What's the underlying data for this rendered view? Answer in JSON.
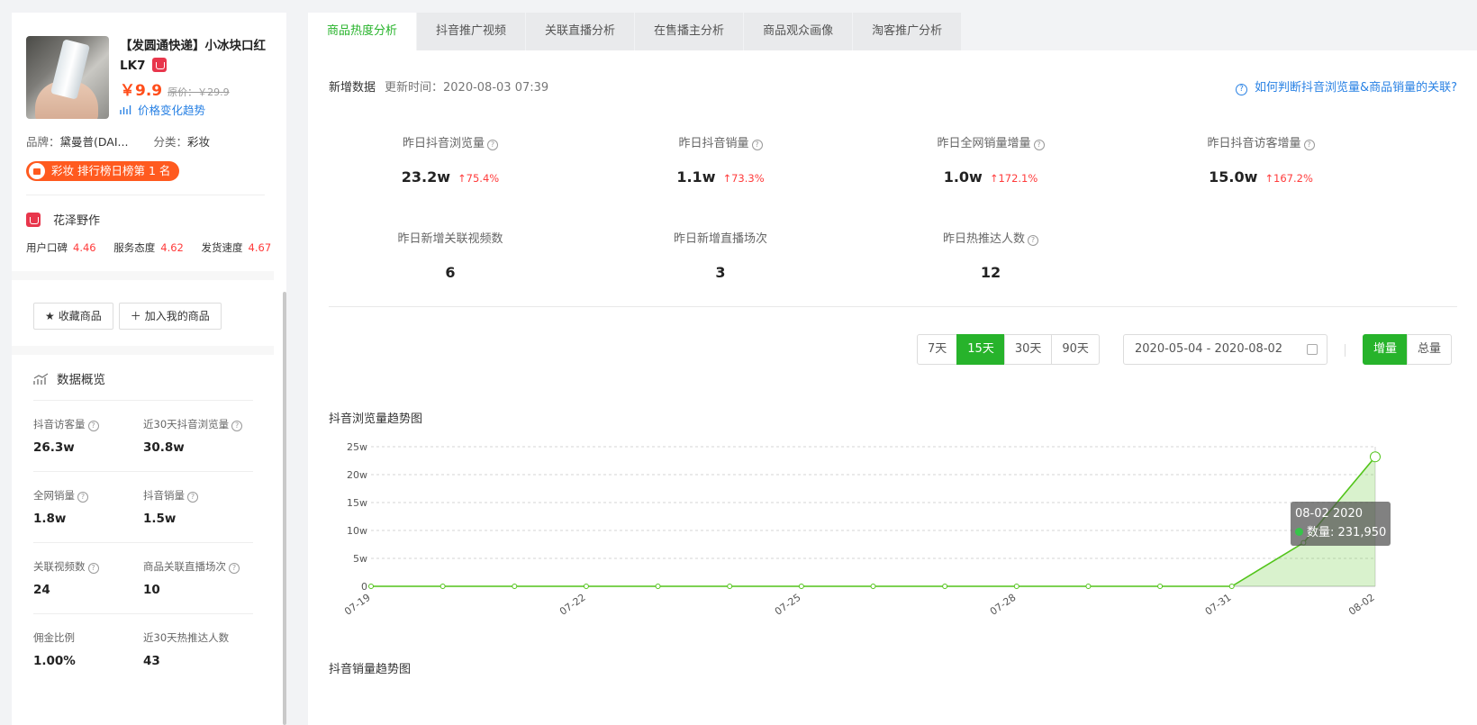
{
  "product": {
    "title": "【发圆通快递】小冰块口红LK7",
    "price": "￥9.9",
    "original_price": "原价：￥29.9",
    "trend_link": "价格变化趋势",
    "brand_label": "品牌：",
    "brand": "黛曼普(DAI...",
    "category_label": "分类：",
    "category": "彩妆",
    "rank_badge": "彩妆 排行榜日榜第 1 名"
  },
  "shop": {
    "name": "花泽野作",
    "scores": [
      {
        "label": "用户口碑",
        "value": "4.46"
      },
      {
        "label": "服务态度",
        "value": "4.62"
      },
      {
        "label": "发货速度",
        "value": "4.67"
      }
    ]
  },
  "actions": {
    "favorite": "收藏商品",
    "add_mine": "加入我的商品"
  },
  "overview": {
    "title": "数据概览",
    "stats": [
      {
        "label": "抖音访客量",
        "value": "26.3w",
        "help": true
      },
      {
        "label": "近30天抖音浏览量",
        "value": "30.8w",
        "help": true
      },
      {
        "label": "全网销量",
        "value": "1.8w",
        "help": true
      },
      {
        "label": "抖音销量",
        "value": "1.5w",
        "help": true
      },
      {
        "label": "关联视频数",
        "value": "24",
        "help": true
      },
      {
        "label": "商品关联直播场次",
        "value": "10",
        "help": true
      },
      {
        "label": "佣金比例",
        "value": "1.00%",
        "help": false
      },
      {
        "label": "近30天热推达人数",
        "value": "43",
        "help": false
      }
    ]
  },
  "tabs": [
    "商品热度分析",
    "抖音推广视频",
    "关联直播分析",
    "在售播主分析",
    "商品观众画像",
    "淘客推广分析"
  ],
  "panel": {
    "section_label": "新增数据",
    "updated": "更新时间：2020-08-03 07:39",
    "help_link": "如何判断抖音浏览量&商品销量的关联?",
    "metrics": [
      {
        "label": "昨日抖音浏览量",
        "value": "23.2w",
        "change": "75.4%",
        "help": true
      },
      {
        "label": "昨日抖音销量",
        "value": "1.1w",
        "change": "73.3%",
        "help": true
      },
      {
        "label": "昨日全网销量增量",
        "value": "1.0w",
        "change": "172.1%",
        "help": true
      },
      {
        "label": "昨日抖音访客增量",
        "value": "15.0w",
        "change": "167.2%",
        "help": true
      },
      {
        "label": "昨日新增关联视频数",
        "value": "6",
        "change": "",
        "help": false
      },
      {
        "label": "昨日新增直播场次",
        "value": "3",
        "change": "",
        "help": false
      },
      {
        "label": "昨日热推达人数",
        "value": "12",
        "change": "",
        "help": true
      }
    ],
    "ranges": [
      "7天",
      "15天",
      "30天",
      "90天"
    ],
    "active_range": "15天",
    "date_range": "2020-05-04 - 2020-08-02",
    "modes": [
      "增量",
      "总量"
    ],
    "active_mode": "增量",
    "chart1_title": "抖音浏览量趋势图",
    "chart2_title": "抖音销量趋势图",
    "tooltip": {
      "date": "08-02 2020",
      "label": "数量: 231,950"
    }
  },
  "colors": {
    "accent": "#27b32b",
    "price": "#ff4d1a",
    "link": "#2a82e4",
    "up": "#ff3b3b",
    "line": "#52c41a"
  },
  "chart_data": {
    "type": "area",
    "x": [
      "07-19",
      "07-20",
      "07-21",
      "07-22",
      "07-23",
      "07-24",
      "07-25",
      "07-26",
      "07-27",
      "07-28",
      "07-29",
      "07-30",
      "07-31",
      "08-01",
      "08-02"
    ],
    "x_tick_labels": [
      "07-19",
      "07-22",
      "07-25",
      "07-28",
      "07-31",
      "08-02"
    ],
    "series": [
      {
        "values": [
          0,
          0,
          0,
          0,
          0,
          0,
          0,
          0,
          0,
          0,
          0,
          0,
          0,
          78000,
          231950
        ]
      }
    ],
    "y_tick_labels": [
      "0",
      "5w",
      "10w",
      "15w",
      "20w",
      "25w"
    ],
    "ylim": [
      0,
      250000
    ],
    "grid": true
  }
}
